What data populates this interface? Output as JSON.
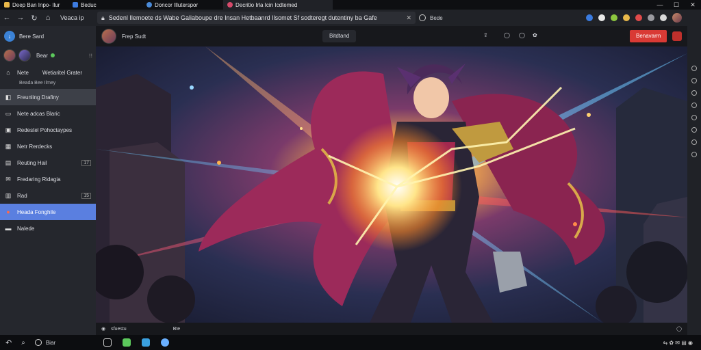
{
  "browser": {
    "tabs": [
      {
        "label": "Deep Ban Inpo- Ilur",
        "color": "#e9b84a"
      },
      {
        "label": "Beduc",
        "color": "#3d7be0"
      },
      {
        "label": "Doncor Illuterspor",
        "color": "#4a8ad8"
      },
      {
        "label": "Decritio Irla Icin Icdtemed",
        "color": "#d64a6b"
      }
    ],
    "nav_label": "Veaca ip",
    "address": "Sedenl Ilemoete ds Wabe Galiaboupe dre Insan Hetbaanrd Ilsomet Sf sodteregt dutentiny ba Gafe",
    "toolbar_right_label": "Bede",
    "accent": "#3b82d6"
  },
  "sidebar": {
    "app_name": "Bere Sard",
    "user_label": "Bear",
    "items": [
      {
        "label": "Nete",
        "extra": "Wetiaritel Grater",
        "icon": "home-icon"
      },
      {
        "label": "Freunling Drafiny",
        "icon": "chat-icon",
        "state": "highlight"
      },
      {
        "label": "Nete adcas Blaric",
        "icon": "folder-icon"
      },
      {
        "label": "Redestel Pohoctaypes",
        "icon": "box-icon"
      },
      {
        "label": "Netr Rerdecks",
        "icon": "grid-icon"
      },
      {
        "label": "Reuting Hail",
        "icon": "chart-icon",
        "badge": "17"
      },
      {
        "label": "Fredaring Ridagia",
        "icon": "mail-icon"
      },
      {
        "label": "Rad",
        "icon": "gift-icon",
        "badge": "15"
      },
      {
        "label": "Heada Fonghile",
        "icon": "flame-icon",
        "state": "selected"
      },
      {
        "label": "Nalede",
        "icon": "window-icon"
      }
    ],
    "sub_label": "Beada Bee Ilmey"
  },
  "main": {
    "author": "Frep Sudt",
    "center_button": "Bitdtand",
    "action_button": "Benavarm",
    "action_color": "#d93a35",
    "bottom_left": "sfuestu",
    "bottom_mid": "Bte"
  },
  "taskbar": {
    "search_label": "Biar"
  }
}
